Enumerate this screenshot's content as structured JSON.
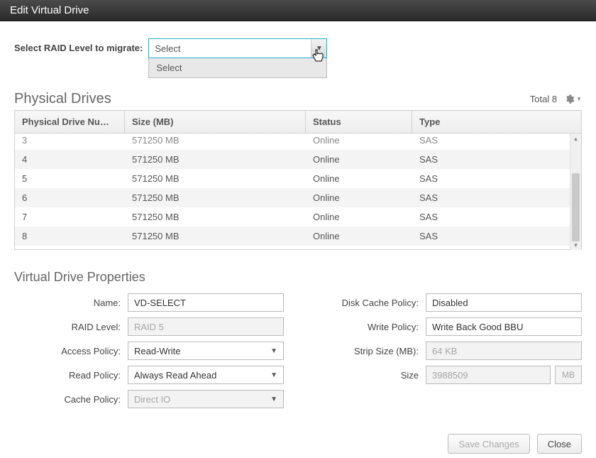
{
  "title": "Edit Virtual Drive",
  "raid_select": {
    "label": "Select RAID Level to migrate:",
    "value": "Select",
    "options": [
      "Select"
    ]
  },
  "physical_drives": {
    "heading": "Physical Drives",
    "total_label": "Total 8",
    "columns": {
      "num": "Physical Drive Nu…",
      "size": "Size (MB)",
      "status": "Status",
      "type": "Type"
    },
    "rows": [
      {
        "num": "3",
        "size": "571250 MB",
        "status": "Online",
        "type": "SAS",
        "cut": true
      },
      {
        "num": "4",
        "size": "571250 MB",
        "status": "Online",
        "type": "SAS"
      },
      {
        "num": "5",
        "size": "571250 MB",
        "status": "Online",
        "type": "SAS"
      },
      {
        "num": "6",
        "size": "571250 MB",
        "status": "Online",
        "type": "SAS"
      },
      {
        "num": "7",
        "size": "571250 MB",
        "status": "Online",
        "type": "SAS"
      },
      {
        "num": "8",
        "size": "571250 MB",
        "status": "Online",
        "type": "SAS"
      }
    ]
  },
  "vd_props": {
    "heading": "Virtual Drive Properties",
    "left": {
      "name_label": "Name:",
      "name_value": "VD-SELECT",
      "raid_level_label": "RAID Level:",
      "raid_level_value": "RAID 5",
      "access_policy_label": "Access Policy:",
      "access_policy_value": "Read-Write",
      "read_policy_label": "Read Policy:",
      "read_policy_value": "Always Read Ahead",
      "cache_policy_label": "Cache Policy:",
      "cache_policy_value": "Direct IO"
    },
    "right": {
      "disk_cache_label": "Disk Cache Policy:",
      "disk_cache_value": "Disabled",
      "write_policy_label": "Write Policy:",
      "write_policy_value": "Write Back Good BBU",
      "strip_size_label": "Strip Size (MB):",
      "strip_size_value": "64 KB",
      "size_label": "Size",
      "size_value": "3988509",
      "size_unit": "MB"
    }
  },
  "footer": {
    "save": "Save Changes",
    "close": "Close"
  }
}
